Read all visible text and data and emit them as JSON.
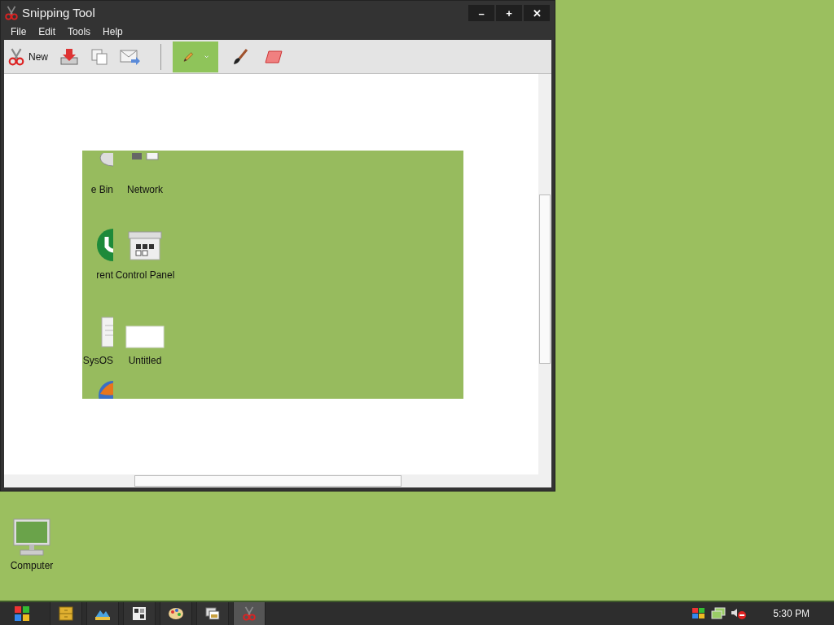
{
  "window": {
    "title": "Snipping Tool",
    "caption_buttons": [
      "–",
      "+",
      "✕"
    ]
  },
  "menu": [
    {
      "label": "File"
    },
    {
      "label": "Edit"
    },
    {
      "label": "Tools"
    },
    {
      "label": "Help"
    }
  ],
  "toolbar": {
    "new_label": "New",
    "tools": [
      {
        "kind": "pen",
        "selected": true
      },
      {
        "kind": "brush",
        "selected": false
      },
      {
        "kind": "eraser",
        "selected": false
      }
    ]
  },
  "snip": {
    "icons": [
      {
        "kind": "recycle",
        "label": "e Bin"
      },
      {
        "kind": "network",
        "label": "Network"
      },
      {
        "kind": "torrent",
        "label": "rent"
      },
      {
        "kind": "control",
        "label": "Control Panel"
      },
      {
        "kind": "doc",
        "label": "SysOS"
      },
      {
        "kind": "blank",
        "label": "Untitled"
      },
      {
        "kind": "globe"
      }
    ]
  },
  "desktop_icons": [
    {
      "label": "Computer"
    }
  ],
  "taskbar": {
    "apps": [
      {
        "kind": "folder",
        "selected": false
      },
      {
        "kind": "photos",
        "selected": false
      },
      {
        "kind": "panel",
        "selected": false
      },
      {
        "kind": "paint",
        "selected": false
      },
      {
        "kind": "viewer",
        "selected": false
      },
      {
        "kind": "scissors",
        "selected": true
      }
    ],
    "clock": "5:30 PM"
  }
}
